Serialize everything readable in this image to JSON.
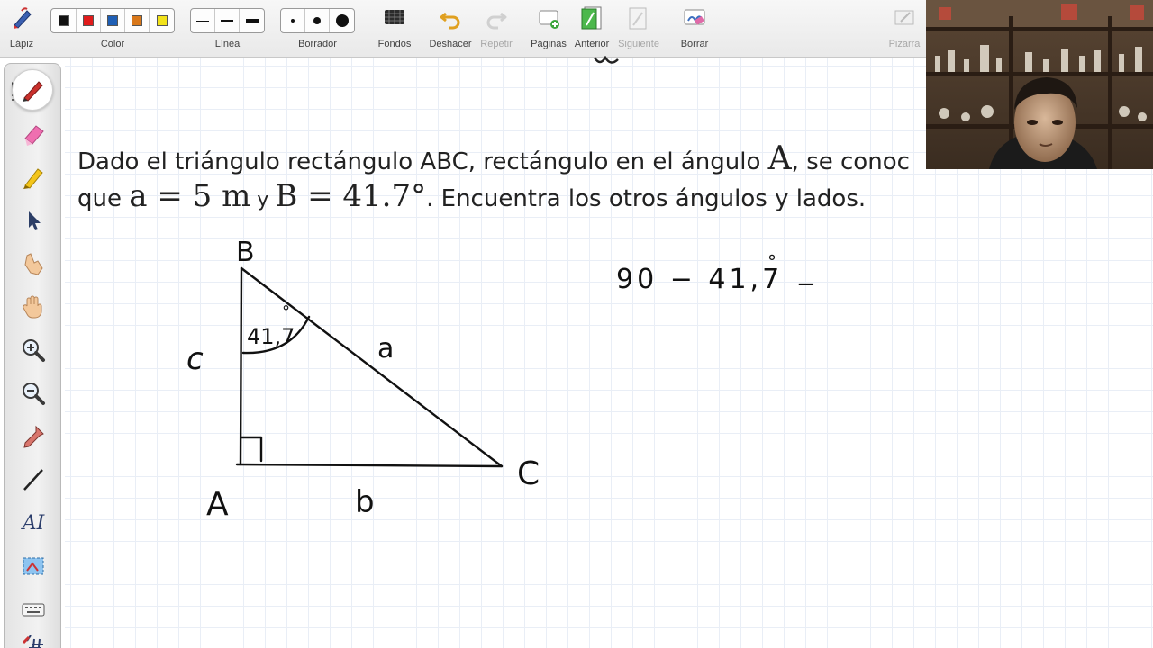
{
  "toolbar": {
    "lapiz": "Lápiz",
    "color": "Color",
    "linea": "Línea",
    "borrador": "Borrador",
    "fondos": "Fondos",
    "deshacer": "Deshacer",
    "repetir": "Repetir",
    "paginas": "Páginas",
    "anterior": "Anterior",
    "siguiente": "Siguiente",
    "borrar": "Borrar",
    "pizarra": "Pizarra",
    "colors": [
      "#111111",
      "#e01b1b",
      "#1f5fb5",
      "#d9781a",
      "#f2e21a"
    ]
  },
  "problem": {
    "line1_text": "Dado el triángulo rectángulo ABC, rectángulo en el ángulo ",
    "line1_math": "A",
    "line1_tail": ", se conoc",
    "line2_que": "que ",
    "line2_math1": "a = 5  m",
    "line2_y": " y ",
    "line2_math2": "B = 41.7°",
    "line2_tail": ". Encuentra los otros ángulos y lados."
  },
  "handwriting": {
    "vertex_b": "B",
    "vertex_a": "A",
    "vertex_c": "C",
    "side_a": "a",
    "side_b": "b",
    "side_c": "c",
    "angle_label": "41,7",
    "degree": "°",
    "calc": "90 − 41,7",
    "calc_tail": "−"
  },
  "sidebar": {
    "tools": [
      "pen-icon",
      "highlighter-icon",
      "marker-icon",
      "pointer-icon",
      "hand-pointer-icon",
      "pan-hand-icon",
      "zoom-in-icon",
      "zoom-out-icon",
      "eyedropper-icon",
      "line-icon",
      "text-icon",
      "screenshot-icon",
      "keyboard-icon",
      "grid-icon"
    ],
    "text_tool_label": "AI"
  }
}
